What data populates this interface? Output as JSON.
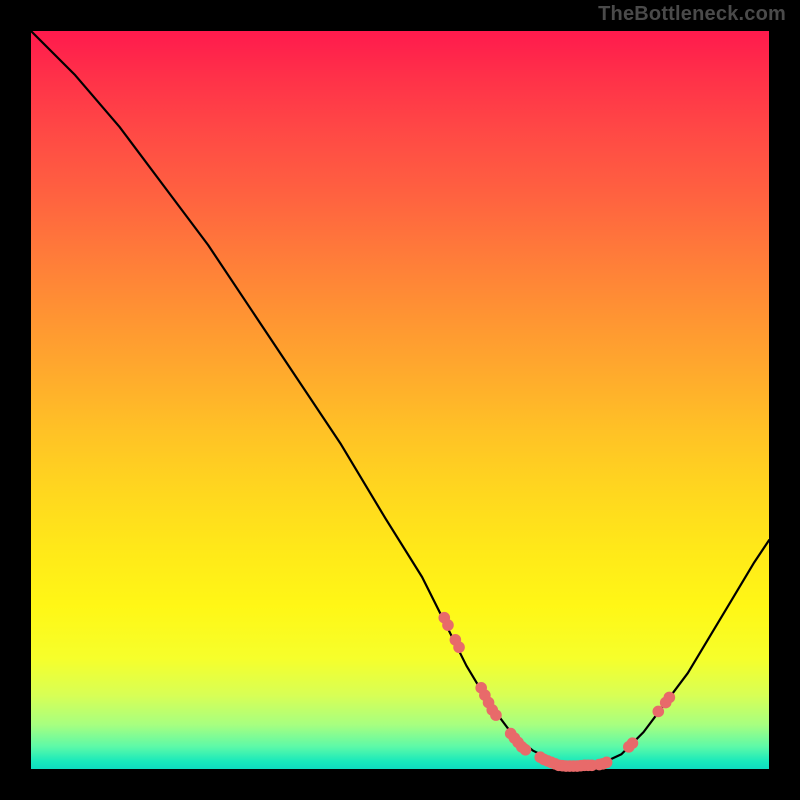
{
  "watermark": "TheBottleneck.com",
  "chart_data": {
    "type": "line",
    "title": "",
    "xlabel": "",
    "ylabel": "",
    "xlim": [
      0,
      100
    ],
    "ylim": [
      0,
      100
    ],
    "curve": [
      {
        "x": 0,
        "y": 100
      },
      {
        "x": 6,
        "y": 94
      },
      {
        "x": 12,
        "y": 87
      },
      {
        "x": 18,
        "y": 79
      },
      {
        "x": 24,
        "y": 71
      },
      {
        "x": 30,
        "y": 62
      },
      {
        "x": 36,
        "y": 53
      },
      {
        "x": 42,
        "y": 44
      },
      {
        "x": 48,
        "y": 34
      },
      {
        "x": 53,
        "y": 26
      },
      {
        "x": 56,
        "y": 20
      },
      {
        "x": 59,
        "y": 14
      },
      {
        "x": 62,
        "y": 9
      },
      {
        "x": 65,
        "y": 5
      },
      {
        "x": 68,
        "y": 2.5
      },
      {
        "x": 71,
        "y": 1
      },
      {
        "x": 74,
        "y": 0.4
      },
      {
        "x": 77,
        "y": 0.6
      },
      {
        "x": 80,
        "y": 2
      },
      {
        "x": 83,
        "y": 5
      },
      {
        "x": 86,
        "y": 9
      },
      {
        "x": 89,
        "y": 13
      },
      {
        "x": 92,
        "y": 18
      },
      {
        "x": 95,
        "y": 23
      },
      {
        "x": 98,
        "y": 28
      },
      {
        "x": 100,
        "y": 31
      }
    ],
    "highlight_points": [
      {
        "x": 56,
        "y": 20.5
      },
      {
        "x": 56.5,
        "y": 19.5
      },
      {
        "x": 57.5,
        "y": 17.5
      },
      {
        "x": 58,
        "y": 16.5
      },
      {
        "x": 61,
        "y": 11
      },
      {
        "x": 61.5,
        "y": 10
      },
      {
        "x": 62,
        "y": 9
      },
      {
        "x": 62.5,
        "y": 8
      },
      {
        "x": 63,
        "y": 7.3
      },
      {
        "x": 65,
        "y": 4.8
      },
      {
        "x": 65.5,
        "y": 4.2
      },
      {
        "x": 66,
        "y": 3.6
      },
      {
        "x": 66.5,
        "y": 3
      },
      {
        "x": 67,
        "y": 2.6
      },
      {
        "x": 69,
        "y": 1.6
      },
      {
        "x": 69.5,
        "y": 1.3
      },
      {
        "x": 70,
        "y": 1.1
      },
      {
        "x": 70.5,
        "y": 0.9
      },
      {
        "x": 71,
        "y": 0.7
      },
      {
        "x": 71.5,
        "y": 0.5
      },
      {
        "x": 72,
        "y": 0.45
      },
      {
        "x": 72.5,
        "y": 0.4
      },
      {
        "x": 73,
        "y": 0.4
      },
      {
        "x": 73.5,
        "y": 0.4
      },
      {
        "x": 74,
        "y": 0.4
      },
      {
        "x": 74.5,
        "y": 0.45
      },
      {
        "x": 75,
        "y": 0.5
      },
      {
        "x": 75.5,
        "y": 0.5
      },
      {
        "x": 76,
        "y": 0.5
      },
      {
        "x": 77,
        "y": 0.6
      },
      {
        "x": 77.5,
        "y": 0.7
      },
      {
        "x": 78,
        "y": 0.9
      },
      {
        "x": 81,
        "y": 3
      },
      {
        "x": 81.5,
        "y": 3.5
      },
      {
        "x": 85,
        "y": 7.8
      },
      {
        "x": 86,
        "y": 9
      },
      {
        "x": 86.5,
        "y": 9.7
      }
    ],
    "colors": {
      "curve": "#000000",
      "highlight": "#e86a6a"
    }
  }
}
